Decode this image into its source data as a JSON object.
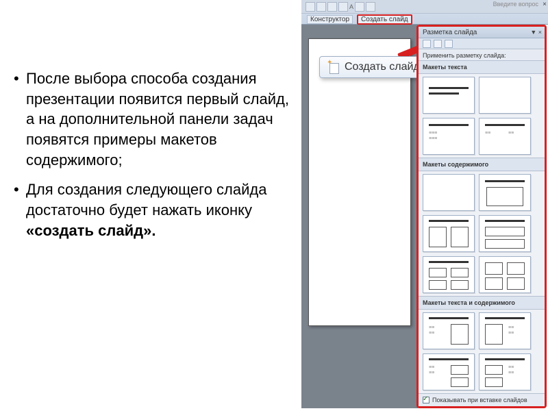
{
  "main": {
    "bullets": [
      "После выбора способа создания презентации появится первый слайд, а на дополнительной панели задач появятся примеры макетов содержимого;",
      "Для создания следующего слайда достаточно будет нажать иконку "
    ],
    "bold_suffix": "«создать слайд»."
  },
  "toolbar": {
    "ask_question": "Введите вопрос",
    "constructor_label": "Конструктор",
    "new_slide_label": "Создать слайд"
  },
  "callout": {
    "label": "Создать слайд"
  },
  "pane": {
    "title": "Разметка слайда",
    "apply_label": "Применить разметку слайда:",
    "sections": {
      "text_layouts": "Макеты текста",
      "content_layouts": "Макеты содержимого",
      "text_and_content": "Макеты текста и содержимого"
    },
    "footer_checkbox": "Показывать при вставке слайдов"
  }
}
